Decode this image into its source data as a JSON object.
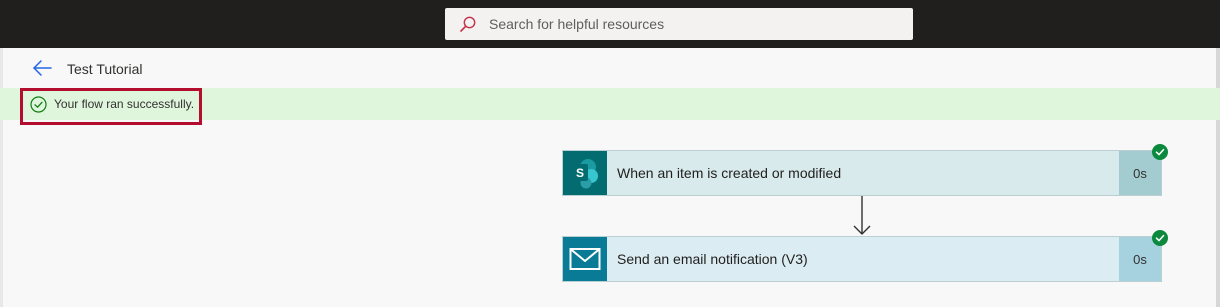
{
  "search": {
    "placeholder": "Search for helpful resources",
    "icon": "search-icon"
  },
  "header": {
    "back_icon": "back-arrow-icon",
    "title": "Test Tutorial"
  },
  "notification": {
    "icon": "success-check-icon",
    "message": "Your flow ran successfully.",
    "status_color": "#107c10",
    "highlight_color": "#b30e2e"
  },
  "steps": [
    {
      "icon": "sharepoint-icon",
      "icon_letter": "S",
      "label": "When an item is created or modified",
      "duration": "0s",
      "status": "succeeded",
      "accent": "#036c70"
    },
    {
      "icon": "mail-icon",
      "label": "Send an email notification (V3)",
      "duration": "0s",
      "status": "succeeded",
      "accent": "#0a7b96"
    }
  ],
  "colors": {
    "topbar": "#201f1e",
    "success_bg": "#dff6dd",
    "check_badge": "#0b8a3e"
  }
}
